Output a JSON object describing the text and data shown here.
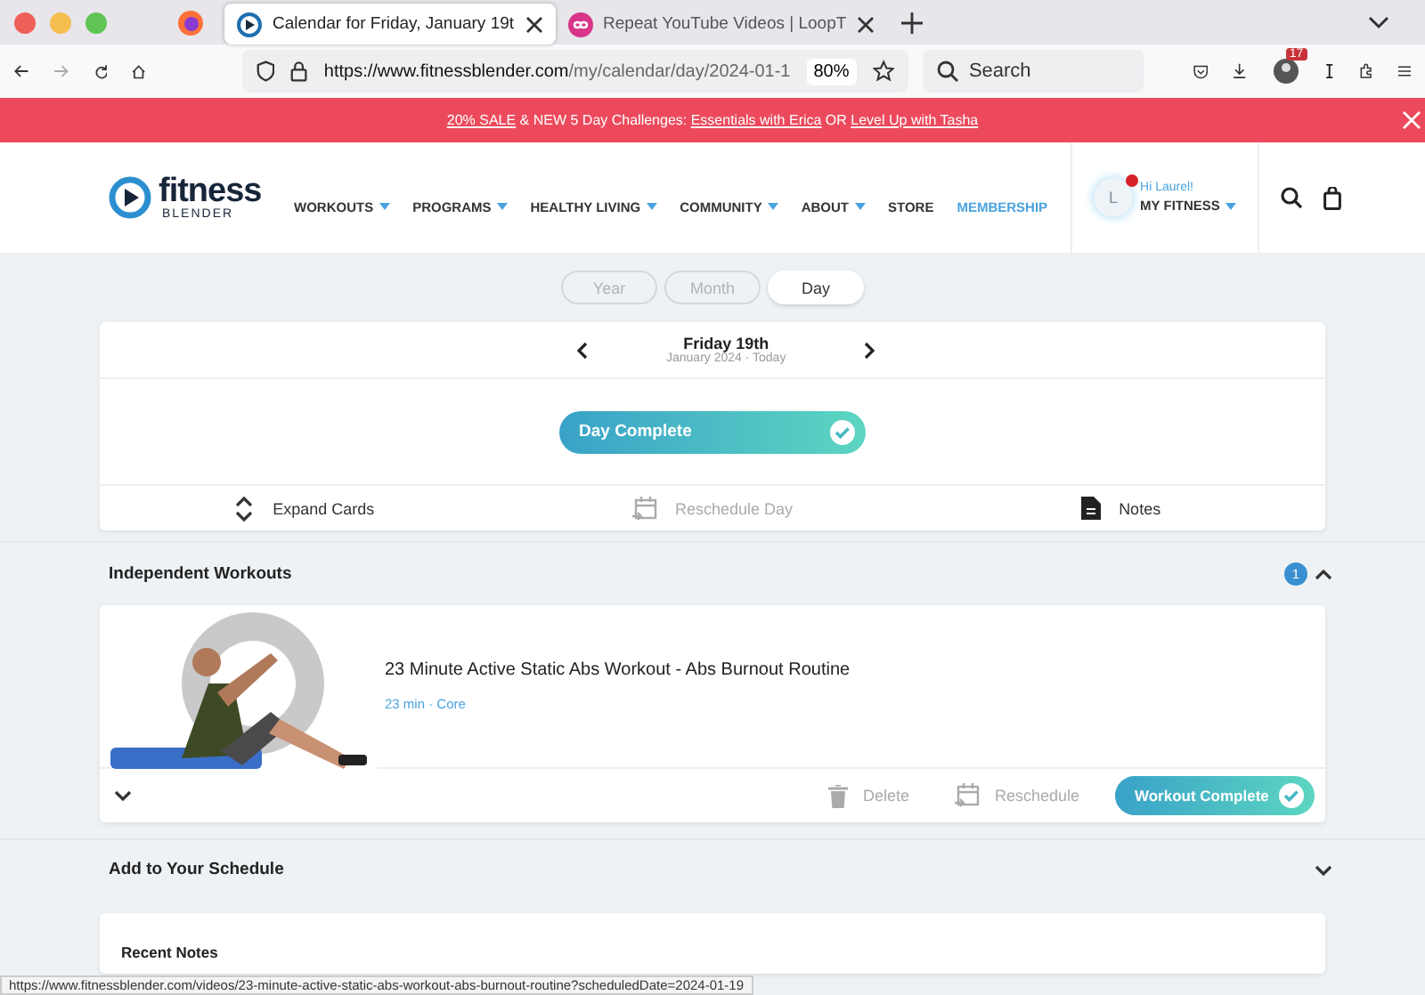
{
  "browser": {
    "tabs": [
      {
        "title": "Calendar for Friday, January 19t",
        "selected": true
      },
      {
        "title": "Repeat YouTube Videos | LoopT",
        "selected": false
      }
    ],
    "url": {
      "domain": "https://www.fitnessblender.com",
      "path": "/my/calendar/day/2024-01-1"
    },
    "zoom": "80%",
    "search": {
      "placeholder": "Search"
    },
    "badge": "17"
  },
  "banner": [
    {
      "text": "20% SALE",
      "link": true
    },
    {
      "text": " & NEW 5 Day Challenges: ",
      "link": false
    },
    {
      "text": "Essentials with Erica",
      "link": true
    },
    {
      "text": " OR ",
      "link": false
    },
    {
      "text": "Level Up with Tasha",
      "link": true
    }
  ],
  "site": {
    "logo": {
      "name": "fitness",
      "sub": "BLENDER"
    },
    "nav": [
      {
        "label": "WORKOUTS",
        "has_menu": true,
        "accent": false
      },
      {
        "label": "PROGRAMS",
        "has_menu": true,
        "accent": false
      },
      {
        "label": "HEALTHY LIVING",
        "has_menu": true,
        "accent": false
      },
      {
        "label": "COMMUNITY",
        "has_menu": true,
        "accent": false
      },
      {
        "label": "ABOUT",
        "has_menu": true,
        "accent": false
      },
      {
        "label": "STORE",
        "has_menu": false,
        "accent": false
      },
      {
        "label": "MEMBERSHIP",
        "has_menu": false,
        "accent": true
      }
    ],
    "user": {
      "initial": "L",
      "greeting": "Hi Laurel!",
      "menu": "MY FITNESS",
      "notification": true
    }
  },
  "views": [
    {
      "label": "Year",
      "selected": false
    },
    {
      "label": "Month",
      "selected": false
    },
    {
      "label": "Day",
      "selected": true
    }
  ],
  "day": {
    "title": "Friday 19th",
    "subtitle": "January 2024 · Today",
    "complete_button": "Day Complete",
    "completed": true,
    "actions": [
      {
        "label": "Expand Cards",
        "disabled": false
      },
      {
        "label": "Reschedule Day",
        "disabled": true
      },
      {
        "label": "Notes",
        "disabled": false
      }
    ]
  },
  "independent": {
    "title": "Independent Workouts",
    "count": "1",
    "expanded": true,
    "workouts": [
      {
        "title": "23 Minute Active Static Abs Workout - Abs Burnout Routine",
        "meta": "23 min · Core",
        "actions": [
          {
            "label": "Delete"
          },
          {
            "label": "Reschedule"
          }
        ],
        "complete_button": "Workout Complete",
        "completed": true
      }
    ]
  },
  "schedule": {
    "title": "Add to Your Schedule",
    "expanded": false
  },
  "notes": {
    "title": "Recent Notes"
  },
  "status_bar": "https://www.fitnessblender.com/videos/23-minute-active-static-abs-workout-abs-burnout-routine?scheduledDate=2024-01-19"
}
